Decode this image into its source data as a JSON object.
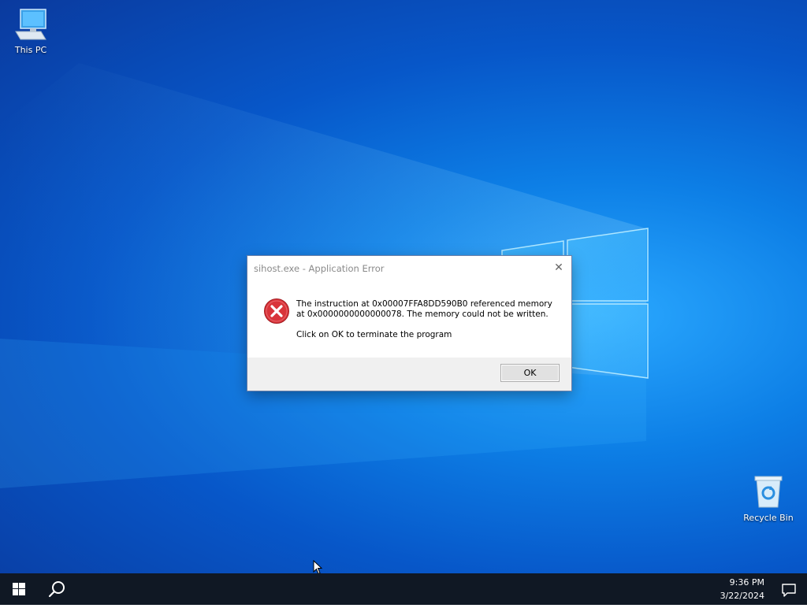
{
  "desktop": {
    "icons": [
      {
        "label": "This PC",
        "icon": "computer-icon"
      },
      {
        "label": "Recycle Bin",
        "icon": "recycle-bin-icon"
      }
    ]
  },
  "dialog": {
    "title": "sihost.exe - Application Error",
    "message": "The instruction at 0x00007FFA8DD590B0 referenced memory at 0x0000000000000078. The memory could not be written.",
    "message2": "Click on OK to terminate the program",
    "ok_label": "OK",
    "close_glyph": "✕",
    "icon": "error-icon"
  },
  "taskbar": {
    "time": "9:36 PM",
    "date": "3/22/2024",
    "start_icon": "windows-start-icon",
    "search_icon": "search-icon",
    "notification_icon": "action-center-icon"
  },
  "colors": {
    "taskbar_bg": "#101824",
    "error_red": "#d9343a",
    "desktop_accent": "#0d7fe6"
  }
}
